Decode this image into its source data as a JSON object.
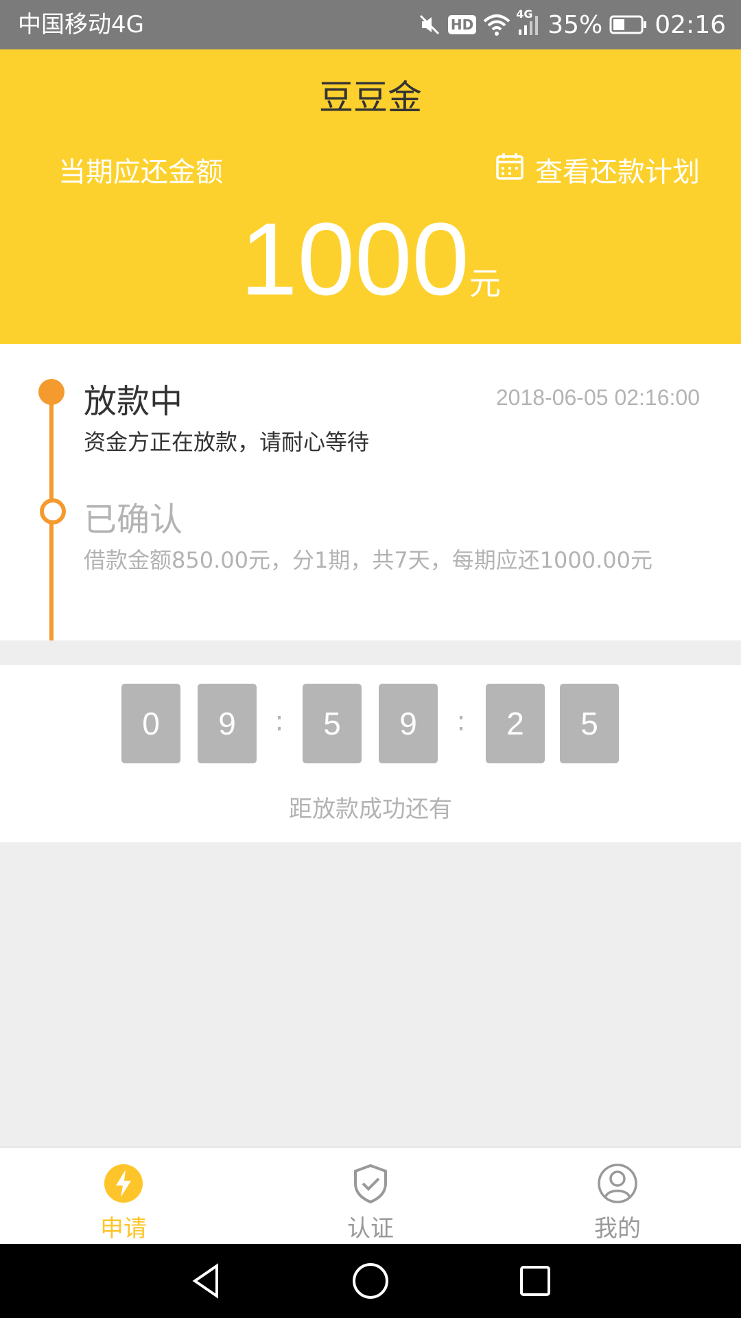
{
  "status_bar": {
    "carrier": "中国移动4G",
    "hd": "HD",
    "network": "4G",
    "battery": "35%",
    "time": "02:16"
  },
  "header": {
    "title": "豆豆金",
    "due_label": "当期应还金额",
    "plan_link": "查看还款计划",
    "amount": "1000",
    "amount_unit": "元"
  },
  "timeline": {
    "steps": [
      {
        "title": "放款中",
        "time": "2018-06-05 02:16:00",
        "desc": "资金方正在放款，请耐心等待",
        "state": "active"
      },
      {
        "title": "已确认",
        "desc": "借款金额850.00元，分1期，共7天，每期应还1000.00元",
        "state": "done"
      }
    ]
  },
  "countdown": {
    "digits": [
      "0",
      "9",
      "5",
      "9",
      "2",
      "5"
    ],
    "separator": ":",
    "caption": "距放款成功还有"
  },
  "bottom_nav": {
    "items": [
      {
        "label": "申请",
        "icon": "lightning-icon",
        "active": true
      },
      {
        "label": "认证",
        "icon": "shield-check-icon",
        "active": false
      },
      {
        "label": "我的",
        "icon": "user-icon",
        "active": false
      }
    ]
  },
  "colors": {
    "brand_yellow": "#fdd12d",
    "timeline_orange": "#f59a2e",
    "inactive_gray": "#b3b3b3",
    "active_nav": "#fdc52a"
  }
}
